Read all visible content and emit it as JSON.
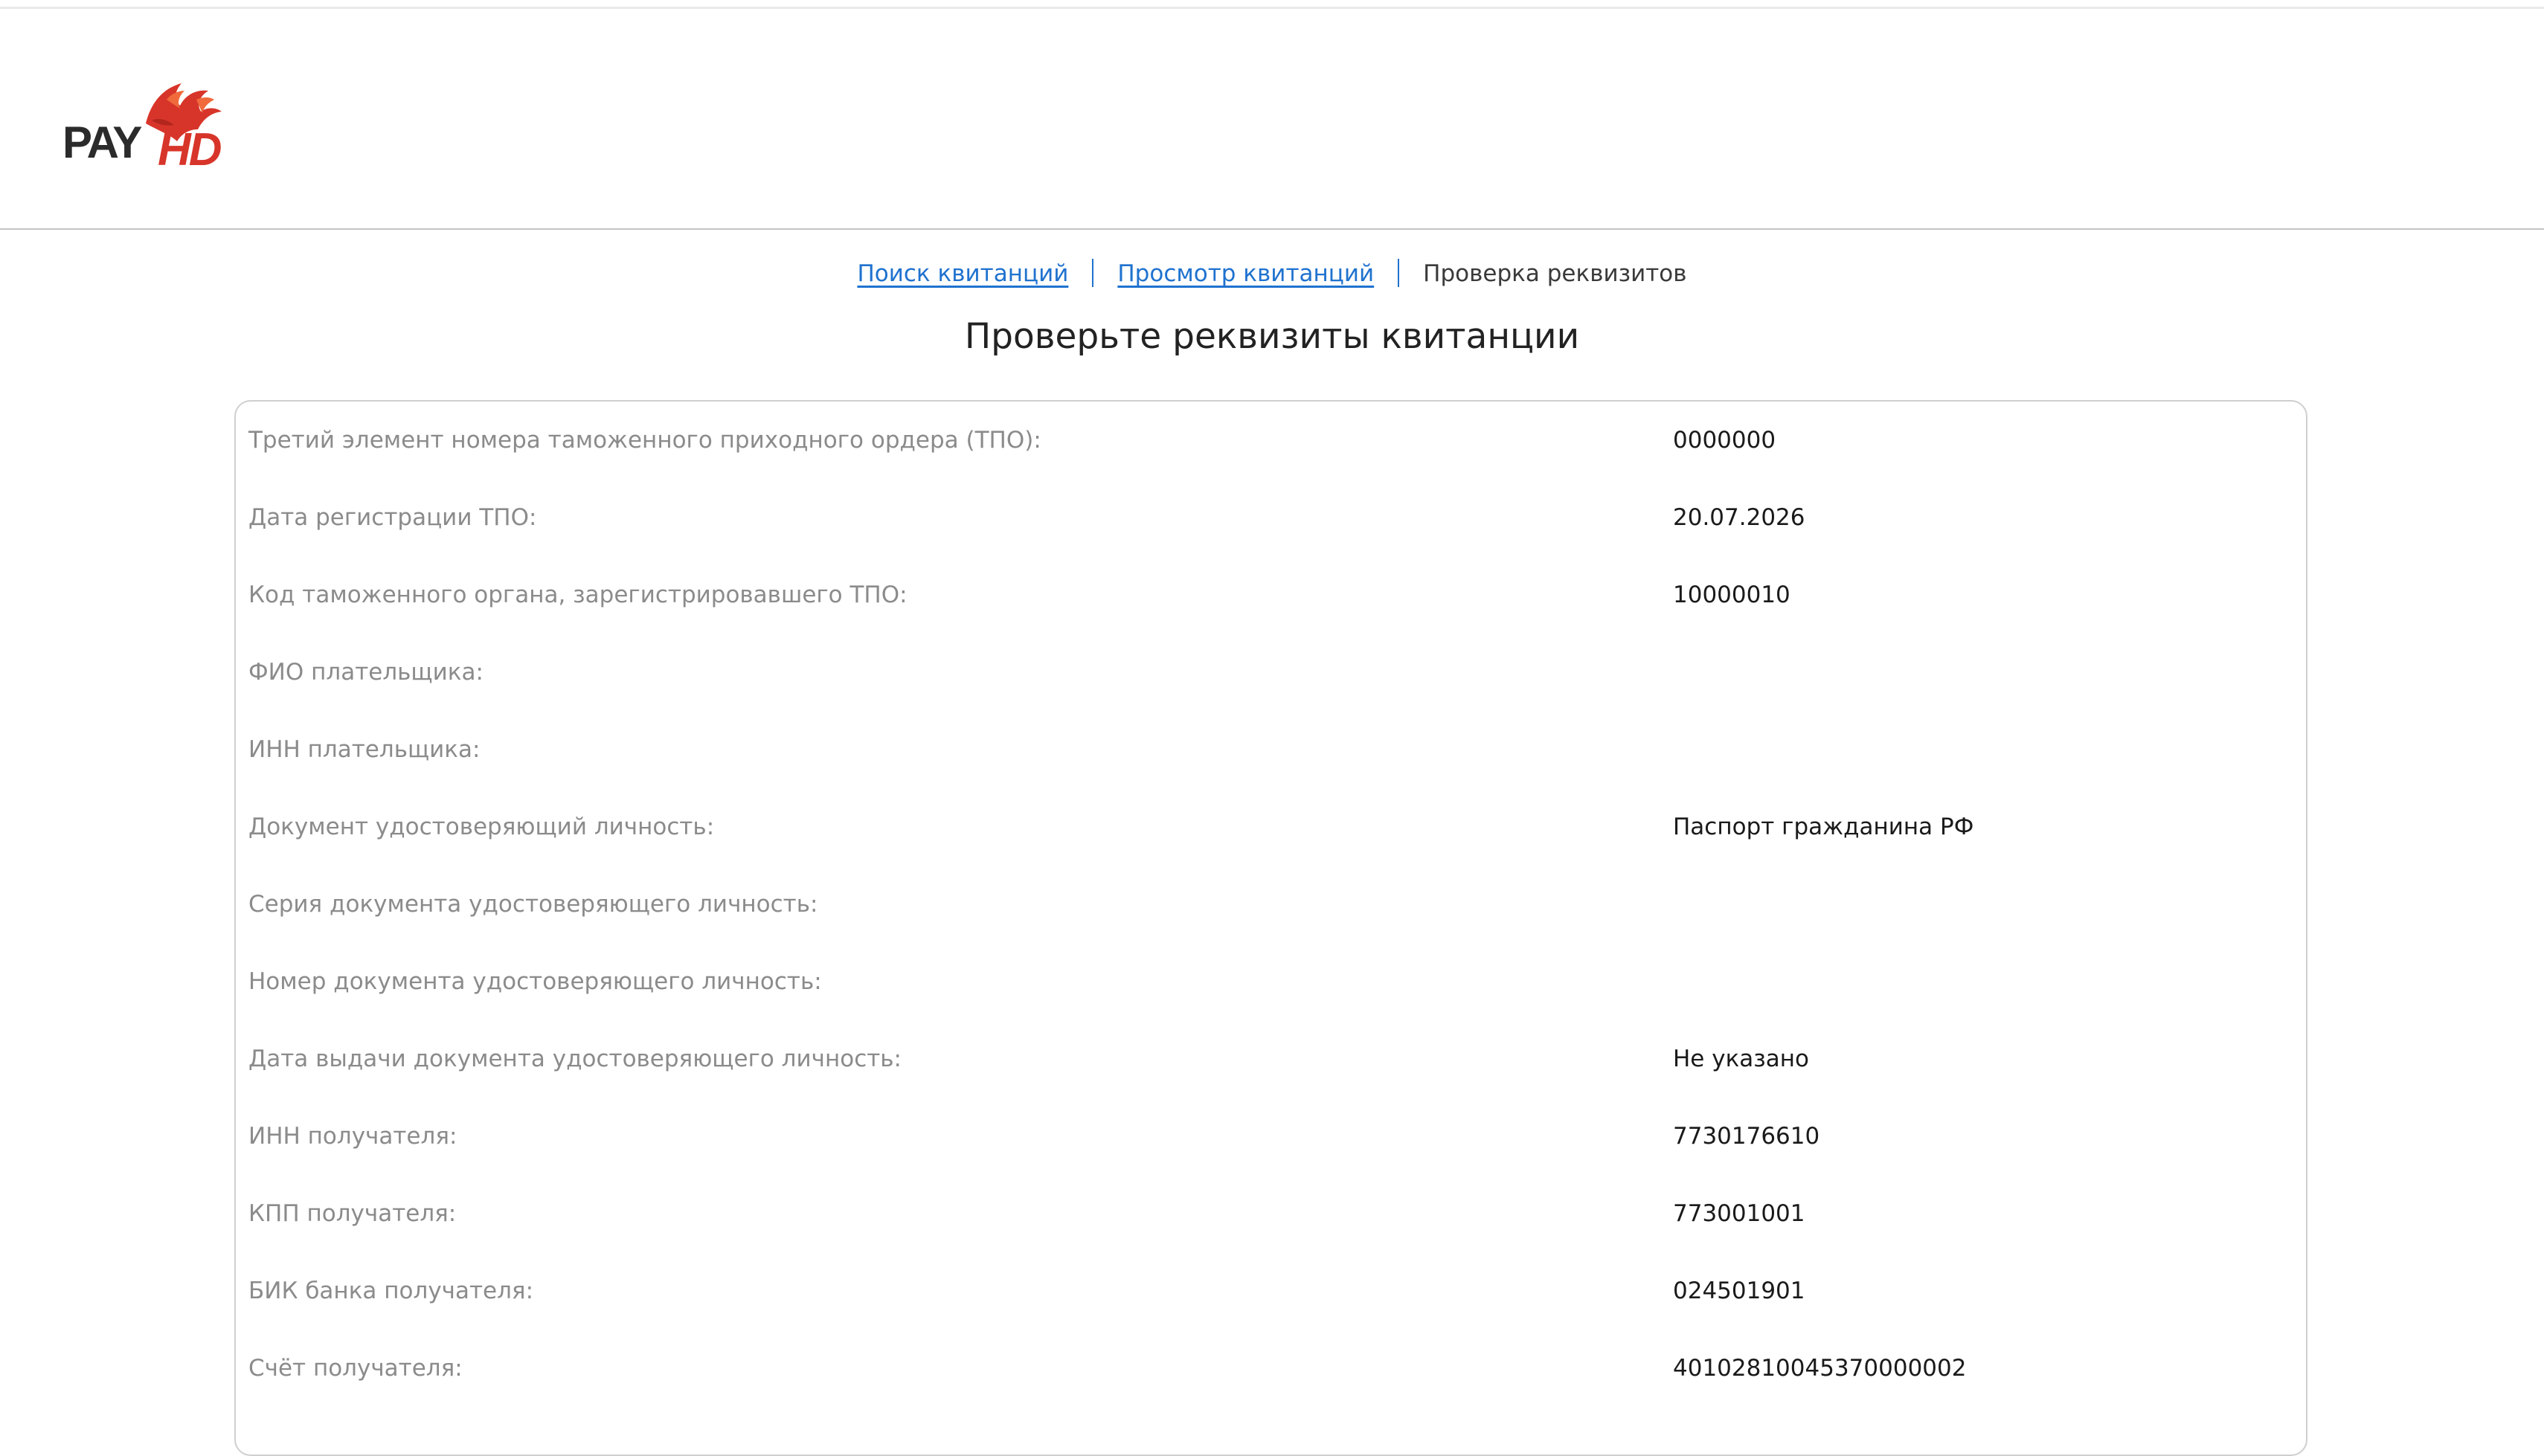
{
  "logo": {
    "brand_left": "PAY",
    "brand_right": "HD"
  },
  "breadcrumb": {
    "items": [
      {
        "label": "Поиск квитанций",
        "type": "link"
      },
      {
        "label": "Просмотр квитанций",
        "type": "link"
      },
      {
        "label": "Проверка реквизитов",
        "type": "current"
      }
    ]
  },
  "page": {
    "title": "Проверьте реквизиты квитанции"
  },
  "details": {
    "rows": [
      {
        "label": "Третий элемент номера таможенного приходного ордера (ТПО):",
        "value": "0000000"
      },
      {
        "label": "Дата регистрации ТПО:",
        "value": "20.07.2026"
      },
      {
        "label": "Код таможенного органа, зарегистрировавшего ТПО:",
        "value": "10000010"
      },
      {
        "label": "ФИО плательщика:",
        "value": ""
      },
      {
        "label": "ИНН плательщика:",
        "value": ""
      },
      {
        "label": "Документ удостоверяющий личность:",
        "value": "Паспорт гражданина РФ"
      },
      {
        "label": "Серия документа удостоверяющего личность:",
        "value": ""
      },
      {
        "label": "Номер документа удостоверяющего личность:",
        "value": ""
      },
      {
        "label": "Дата выдачи документа удостоверяющего личность:",
        "value": "Не указано"
      },
      {
        "label": "ИНН получателя:",
        "value": "7730176610"
      },
      {
        "label": "КПП получателя:",
        "value": "773001001"
      },
      {
        "label": "БИК банка получателя:",
        "value": "024501901"
      },
      {
        "label": "Счёт получателя:",
        "value": "40102810045370000002"
      }
    ]
  },
  "colors": {
    "link": "#1f72cf",
    "label_text": "#8b8b8b",
    "value_text": "#1a1a1a",
    "logo_dark": "#2b2b2b",
    "logo_red": "#d8352a"
  }
}
